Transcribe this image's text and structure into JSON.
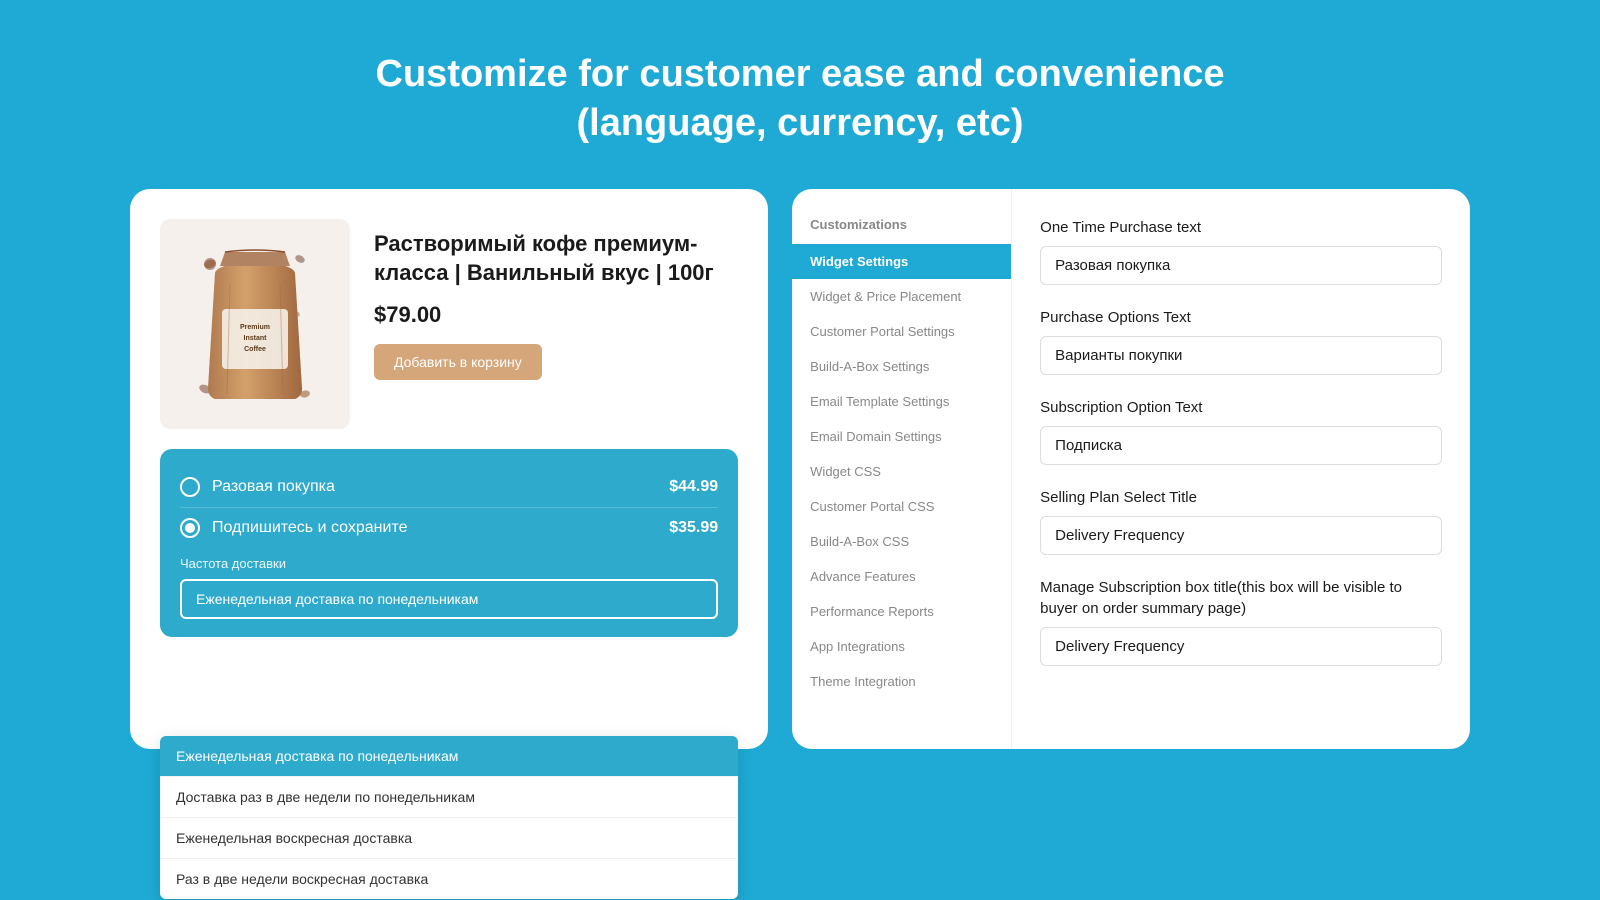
{
  "headline": {
    "line1": "Customize for customer ease and convenience",
    "line2": "(language, currency, etc)"
  },
  "left_card": {
    "product": {
      "title": "Растворимый кофе премиум-класса | Ванильный вкус | 100г",
      "price": "$79.00",
      "add_to_cart_label": "Добавить в корзину"
    },
    "widget": {
      "option1_label": "Разовая покупка",
      "option1_price": "$44.99",
      "option2_label": "Подпишитесь и сохраните",
      "option2_price": "$35.99",
      "frequency_label": "Частота доставки",
      "selected_option": "Еженедельная доставка по понедельникам",
      "dropdown_items": [
        "Еженедельная доставка по понедельникам",
        "Доставка раз в две недели по понедельникам",
        "Еженедельная воскресная доставка",
        "Раз в две недели воскресная доставка"
      ]
    }
  },
  "right_card": {
    "sidebar": {
      "section_title": "Customizations",
      "items": [
        {
          "id": "widget-settings",
          "label": "Widget Settings",
          "active": true
        },
        {
          "id": "widget-price",
          "label": "Widget & Price Placement",
          "active": false
        },
        {
          "id": "customer-portal",
          "label": "Customer Portal Settings",
          "active": false
        },
        {
          "id": "build-a-box",
          "label": "Build-A-Box Settings",
          "active": false
        },
        {
          "id": "email-template",
          "label": "Email Template Settings",
          "active": false
        },
        {
          "id": "email-domain",
          "label": "Email Domain Settings",
          "active": false
        },
        {
          "id": "widget-css",
          "label": "Widget CSS",
          "active": false
        },
        {
          "id": "customer-portal-css",
          "label": "Customer Portal CSS",
          "active": false
        },
        {
          "id": "build-a-box-css",
          "label": "Build-A-Box CSS",
          "active": false
        },
        {
          "id": "advance-features",
          "label": "Advance Features",
          "active": false
        },
        {
          "id": "performance-reports",
          "label": "Performance Reports",
          "active": false
        },
        {
          "id": "app-integrations",
          "label": "App Integrations",
          "active": false
        },
        {
          "id": "theme-integration",
          "label": "Theme Integration",
          "active": false
        }
      ]
    },
    "settings": {
      "fields": [
        {
          "id": "one-time-purchase",
          "label": "One Time Purchase text",
          "value": "Разовая покупка"
        },
        {
          "id": "purchase-options",
          "label": "Purchase Options Text",
          "value": "Варианты покупки"
        },
        {
          "id": "subscription-option",
          "label": "Subscription Option Text",
          "value": "Подписка"
        },
        {
          "id": "selling-plan",
          "label": "Selling Plan Select Title",
          "value": "Delivery Frequency"
        },
        {
          "id": "manage-subscription",
          "label": "Manage Subscription box title(this box will be visible to buyer on order summary page)",
          "value": "Delivery Frequency"
        }
      ]
    }
  }
}
